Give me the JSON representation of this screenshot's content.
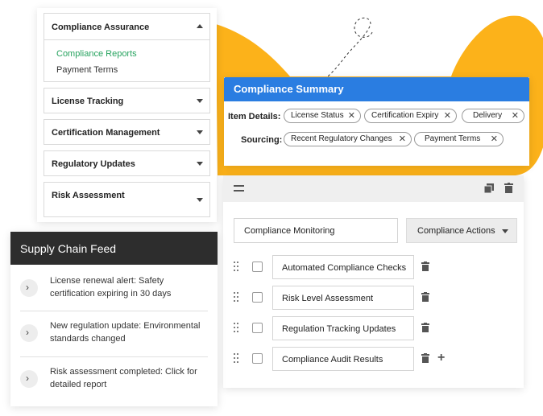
{
  "colors": {
    "accent_blue": "#2a7de1",
    "active_green": "#27a35f",
    "blob_orange": "#fcb21a",
    "feed_dark": "#2d2d2d"
  },
  "accordion": {
    "sections": [
      {
        "label": "Compliance Assurance",
        "expanded": true,
        "items": [
          "Compliance Reports",
          "Payment Terms"
        ],
        "active_item": "Compliance Reports"
      },
      {
        "label": "License Tracking",
        "expanded": false
      },
      {
        "label": "Certification Management",
        "expanded": false
      },
      {
        "label": "Regulatory Updates",
        "expanded": false
      },
      {
        "label": "Risk Assessment",
        "expanded": false
      }
    ]
  },
  "summary": {
    "title": "Compliance Summary",
    "item_details_label": "Item Details:",
    "item_details": [
      "License Status",
      "Certification Expiry",
      "Delivery"
    ],
    "sourcing_label": "Sourcing:",
    "sourcing": [
      "Recent Regulatory Changes",
      "Payment Terms"
    ],
    "remove_glyph": "✕"
  },
  "builder": {
    "name_field": "Compliance Monitoring",
    "actions_label": "Compliance Actions",
    "tasks": [
      "Automated Compliance Checks",
      "Risk Level Assessment",
      "Regulation Tracking Updates",
      "Compliance Audit Results"
    ],
    "add_glyph": "+"
  },
  "feed": {
    "title": "Supply Chain Feed",
    "items": [
      "License renewal alert: Safety certification expiring in 30 days",
      "New regulation update: Environmental standards changed",
      "Risk assessment completed: Click for detailed report"
    ],
    "chevron_glyph": "›"
  }
}
